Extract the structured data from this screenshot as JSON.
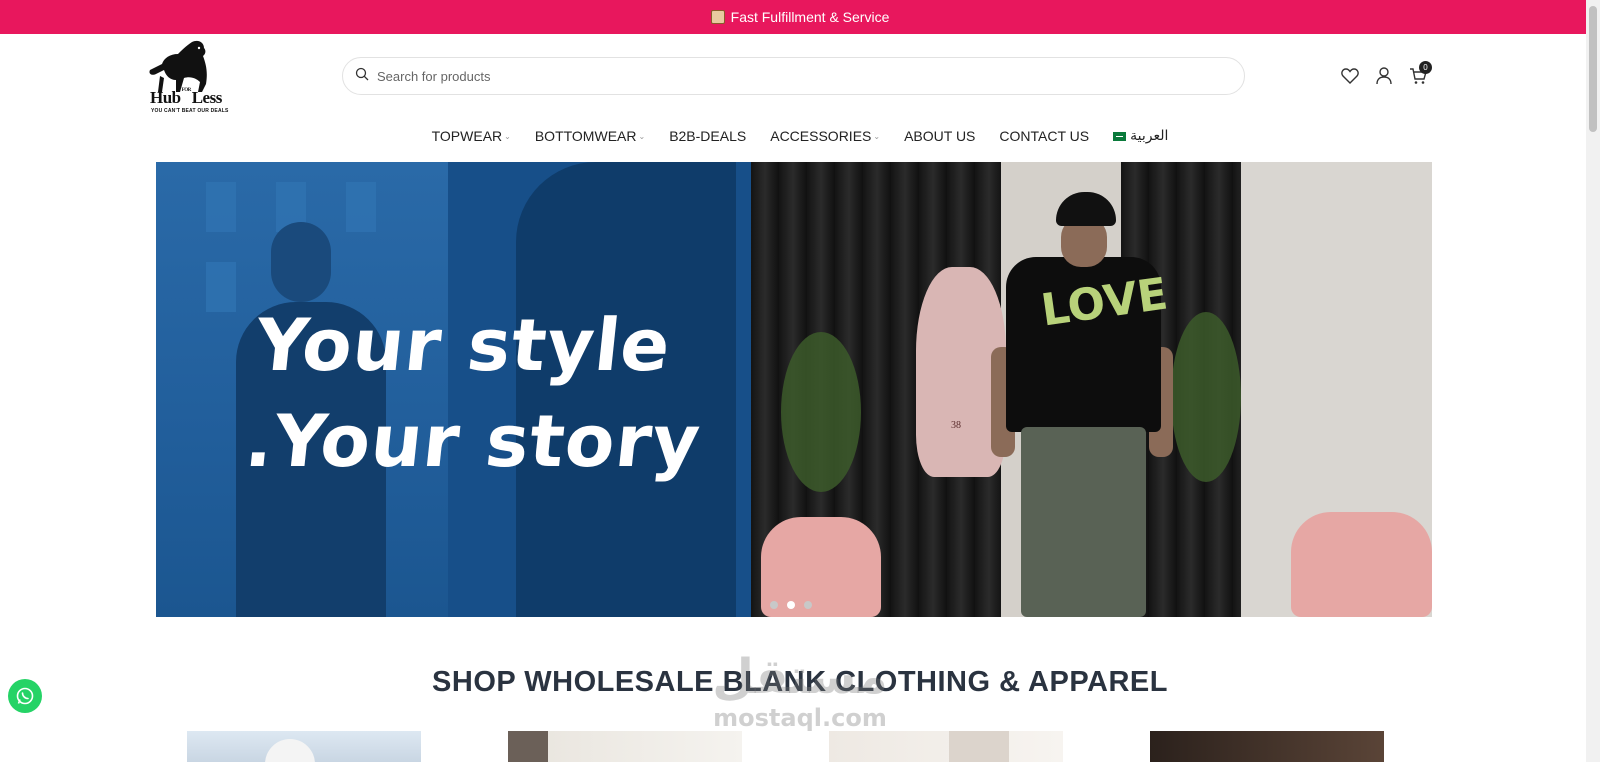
{
  "announcement": {
    "text": "Fast Fulfillment & Service",
    "icon": "box-icon"
  },
  "brand": {
    "name_left": "Hub",
    "name_for": "FOR",
    "name_right": "Less",
    "tagline": "YOU CAN'T BEAT OUR DEALS",
    "accent_color": "#e8175d"
  },
  "search": {
    "placeholder": "Search for products",
    "value": ""
  },
  "header_icons": {
    "wishlist": "heart-icon",
    "account": "user-icon",
    "cart": "cart-icon",
    "cart_count": "0"
  },
  "nav": {
    "items": [
      {
        "label": "TOPWEAR",
        "has_dropdown": true
      },
      {
        "label": "BOTTOMWEAR",
        "has_dropdown": true
      },
      {
        "label": "B2B-DEALS",
        "has_dropdown": false
      },
      {
        "label": "ACCESSORIES",
        "has_dropdown": true
      },
      {
        "label": "ABOUT US",
        "has_dropdown": false
      },
      {
        "label": "CONTACT US",
        "has_dropdown": false
      }
    ],
    "language": "العربية"
  },
  "hero": {
    "line1": "Your style",
    "line2": ".Your story",
    "shirt_text": "LOVE",
    "tag_number": "38",
    "slides": 3,
    "active_slide": 2
  },
  "section": {
    "title": "SHOP WHOLESALE BLANK CLOTHING & APPAREL"
  },
  "watermark": {
    "arabic": "مستقل",
    "latin": "mostaql.com"
  },
  "chat": {
    "icon": "whatsapp-icon"
  }
}
